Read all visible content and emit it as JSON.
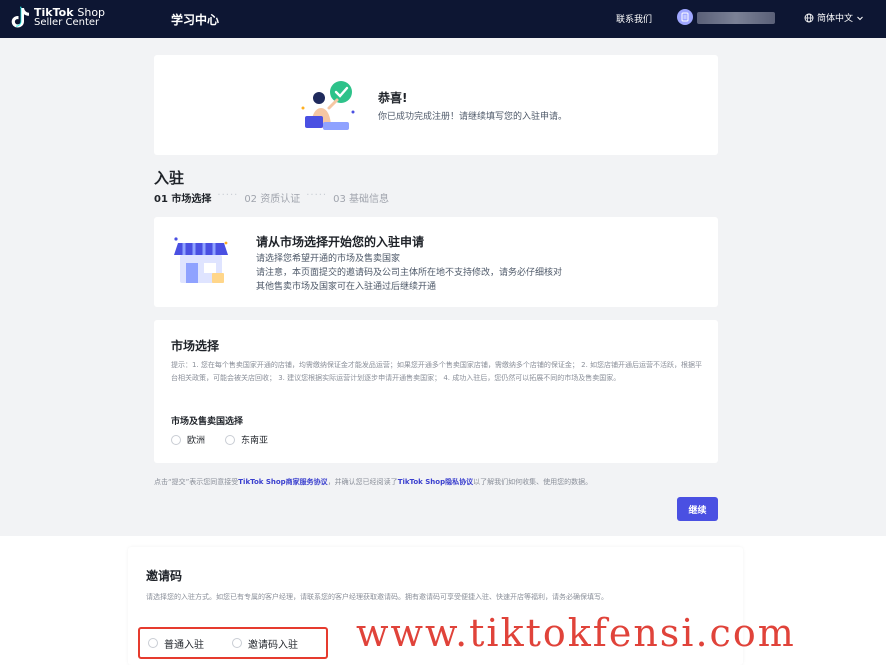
{
  "header": {
    "logo_line1_bold": "TikTok",
    "logo_line1_rest": "Shop",
    "logo_line2": "Seller Center",
    "nav_title": "学习中心",
    "contact": "联系我们",
    "lang": "简体中文"
  },
  "success_card": {
    "title": "恭喜!",
    "subtitle": "你已成功完成注册！请继续填写您的入驻申请。"
  },
  "onboarding": {
    "title": "入驻",
    "steps": [
      "01 市场选择",
      "02 资质认证",
      "03 基础信息"
    ],
    "dots": "·····"
  },
  "market_intro": {
    "title": "请从市场选择开始您的入驻申请",
    "line1": "请选择您希望开通的市场及售卖国家",
    "line2": "请注意，本页面提交的邀请码及公司主体所在地不支持修改，请务必仔细核对",
    "line3": "其他售卖市场及国家可在入驻通过后继续开通"
  },
  "market_select": {
    "title": "市场选择",
    "tip": "提示：1. 您在每个售卖国家开通的店铺，均需缴纳保证金才能发品运营；如果您开通多个售卖国家店铺，需缴纳多个店铺的保证金； 2. 如您店铺开通后运营不活跃，根据平台相关政策，可能会被关店回收； 3. 建议您根据实际运营计划逐步申请开通售卖国家； 4. 成功入驻后，您仍然可以拓展不同的市场及售卖国家。",
    "sub_title": "市场及售卖国选择",
    "options": [
      "欧洲",
      "东南亚"
    ]
  },
  "agreement": {
    "prefix": "点击“提交”表示您同意接受",
    "link1": "TikTok Shop商家服务协议",
    "middle": "，并确认您已经阅读了",
    "link2": "TikTok Shop隐私协议",
    "suffix": "以了解我们如何收集、使用您的数据。"
  },
  "continue_label": "继续",
  "invite": {
    "title": "邀请码",
    "desc": "请选择您的入驻方式。如您已有专属的客户经理，请联系您的客户经理获取邀请码。拥有邀请码可享受便捷入驻、快速开店等福利，请务必确保填写。",
    "options": [
      "普通入驻",
      "邀请码入驻"
    ]
  },
  "watermark": "www.tiktokfensi.com",
  "colors": {
    "topbar": "#0d1633",
    "accent": "#4a50e2",
    "highlight": "#e63b2e"
  }
}
